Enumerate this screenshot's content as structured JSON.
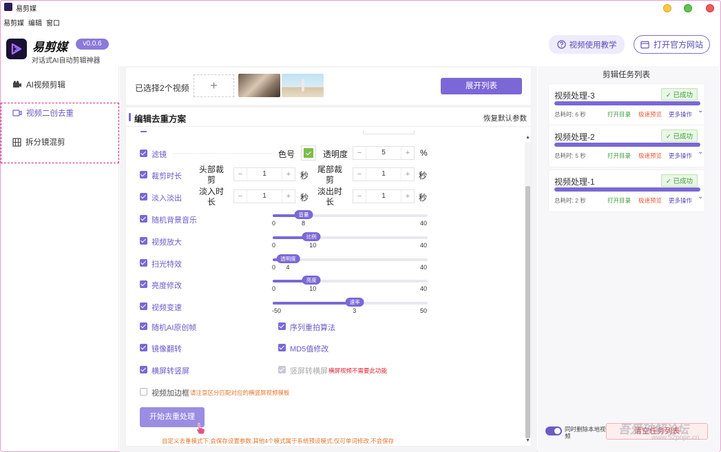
{
  "window": {
    "title": "易剪媒"
  },
  "menu": [
    "易剪媒",
    "编辑",
    "窗口"
  ],
  "brand": {
    "name": "易剪媒",
    "version": "v0.0.6",
    "tagline": "对话式AI自动剪辑神器"
  },
  "header": {
    "tutorial": "视频使用教学",
    "official_site": "打开官方网站"
  },
  "sidebar": {
    "items": [
      {
        "label": "AI视频剪辑",
        "icon": "video-camera-icon"
      },
      {
        "label": "视频二创去重",
        "icon": "clip-icon"
      },
      {
        "label": "拆分镜混剪",
        "icon": "film-grid-icon"
      }
    ]
  },
  "selection": {
    "text": "已选择2个视频",
    "add_symbol": "+",
    "expand": "展开列表"
  },
  "editor": {
    "title": "编辑去重方案",
    "reset": "恢复默认参数",
    "filter": {
      "label": "滤镜",
      "color_label": "色号",
      "color": "#7cbd4a",
      "opacity_label": "透明度",
      "opacity": "5",
      "unit": "%"
    },
    "trim": {
      "label": "裁剪时长",
      "head_label": "头部裁剪",
      "head": "1",
      "tail_label": "尾部裁剪",
      "tail": "1",
      "unit": "秒"
    },
    "fade": {
      "label": "淡入淡出",
      "in_label": "淡入时长",
      "in": "1",
      "out_label": "淡出时长",
      "out": "1",
      "unit": "秒"
    },
    "sliders": [
      {
        "label": "随机背景音乐",
        "tag": "音量",
        "min": "0",
        "max": "40",
        "value": "8",
        "fraction": 0.2
      },
      {
        "label": "视频放大",
        "tag": "比例",
        "min": "0",
        "max": "40",
        "value": "10",
        "fraction": 0.25
      },
      {
        "label": "扫光特效",
        "tag": "透明度",
        "min": "0",
        "max": "40",
        "value": "4",
        "fraction": 0.1
      },
      {
        "label": "亮度修改",
        "tag": "亮度",
        "min": "0",
        "max": "40",
        "value": "10",
        "fraction": 0.25
      },
      {
        "label": "视频变速",
        "tag": "速率",
        "min": "-50",
        "max": "50",
        "value": "3",
        "fraction": 0.53
      }
    ],
    "options_left": [
      "随机AI原创帧",
      "镜像翻转",
      "横屏转竖屏"
    ],
    "options_right": [
      "序列重拍算法",
      "MD5值修改",
      "竖屏转横屏"
    ],
    "landscape_note": "横屏视频不需要此功能",
    "border": {
      "label": "视频加边框",
      "note": "请注意区分匹配对应的横竖屏视频模板"
    },
    "start": "开始去重处理",
    "footer_note": "自定义去重模式下,会保存设置参数,其他4个模式属于系统预设模式,仅可单词修改,不会保存"
  },
  "tasks": {
    "title": "剪辑任务列表",
    "items": [
      {
        "name": "视频处理-3",
        "status": "✓ 已成功",
        "progress": 1.0,
        "time": "总耗时: 6 秒"
      },
      {
        "name": "视频处理-2",
        "status": "✓ 已成功",
        "progress": 1.0,
        "time": "总耗时: 5 秒"
      },
      {
        "name": "视频处理-1",
        "status": "✓ 已成功",
        "progress": 1.0,
        "time": "总耗时: 2 秒"
      }
    ],
    "op_open": "打开目录",
    "op_preview": "极速预览",
    "op_more": "更多操作",
    "delete_local": "同时删除本地视频",
    "clear": "清空任务列表"
  },
  "watermark": {
    "text": "www.52pojie.cn",
    "brand": "吾爱破解论坛"
  }
}
